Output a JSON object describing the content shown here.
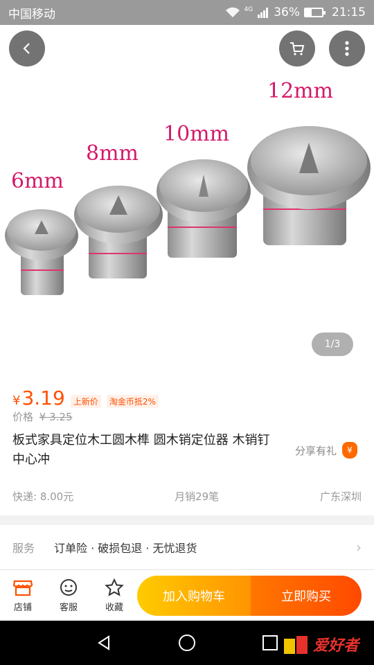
{
  "status": {
    "carrier": "中国移动",
    "network": "4G",
    "battery": "36%",
    "battery_level": 0.36,
    "time": "21:15"
  },
  "gallery": {
    "labels": [
      "6mm",
      "8mm",
      "10mm",
      "12mm"
    ],
    "page_indicator": "1/3"
  },
  "product": {
    "currency": "¥",
    "price": "3.19",
    "tag_new": "上新价",
    "tag_coin": "淘金币抵2%",
    "orig_label": "价格",
    "orig_price": "¥ 3.25",
    "title": "板式家具定位木工圆木榫 圆木销定位器 木销钉中心冲",
    "share_label": "分享有礼",
    "share_icon": "money-bag-icon",
    "shipping": "快递: 8.00元",
    "monthly_sales": "月销29笔",
    "location": "广东深圳"
  },
  "service": {
    "label": "服务",
    "text": "订单险 · 破损包退 · 无忧退货"
  },
  "bottom": {
    "shop": "店铺",
    "support": "客服",
    "favorite": "收藏",
    "add_cart": "加入购物车",
    "buy_now": "立即购买"
  },
  "watermark": {
    "text": "爱好者"
  },
  "colors": {
    "accent": "#ff5000",
    "cart_gradient": [
      "#ffcb00",
      "#ff9402"
    ],
    "buy_gradient": [
      "#ff7700",
      "#ff4900"
    ]
  }
}
